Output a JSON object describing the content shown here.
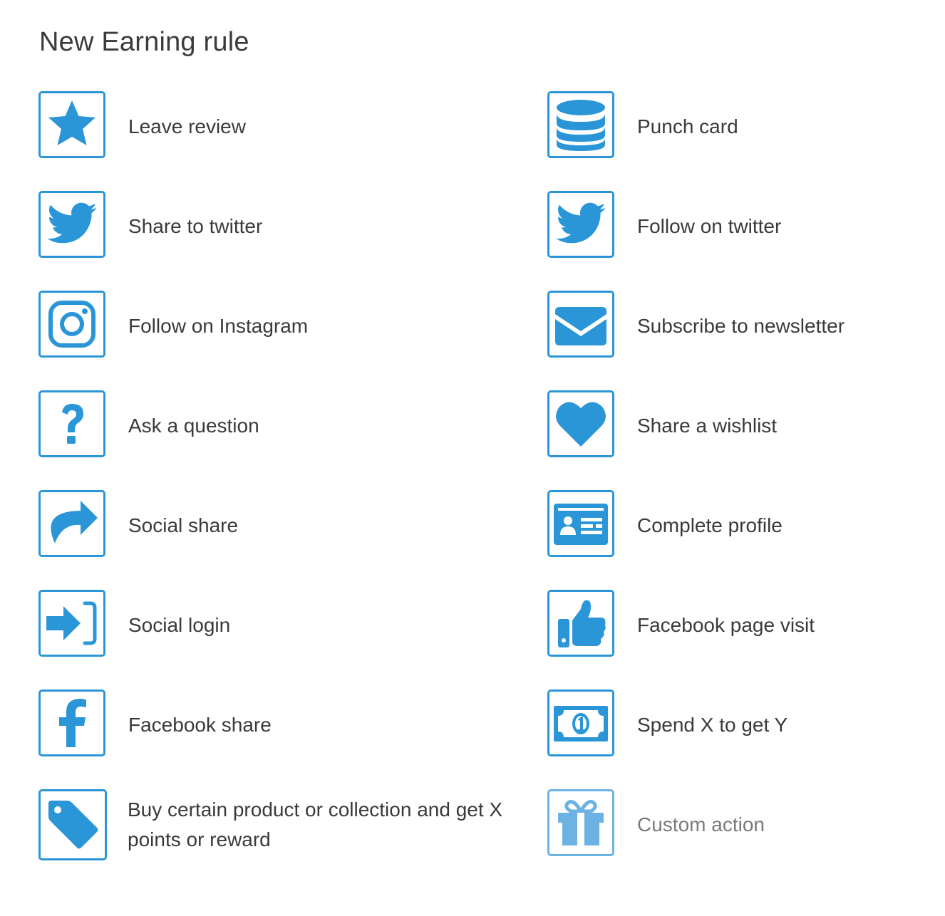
{
  "page": {
    "title": "New Earning rule"
  },
  "colors": {
    "accent": "#2a96d8",
    "accent_disabled": "#6cb3e3",
    "text": "#3a3a3a",
    "text_disabled": "#7a7a7a"
  },
  "rules": [
    {
      "label": "Leave review",
      "icon": "star-icon"
    },
    {
      "label": "Punch card",
      "icon": "database-icon"
    },
    {
      "label": "Share to twitter",
      "icon": "twitter-icon"
    },
    {
      "label": "Follow on twitter",
      "icon": "twitter-icon"
    },
    {
      "label": "Follow on Instagram",
      "icon": "instagram-icon"
    },
    {
      "label": "Subscribe to newsletter",
      "icon": "envelope-icon"
    },
    {
      "label": "Ask a question",
      "icon": "question-icon"
    },
    {
      "label": "Share a wishlist",
      "icon": "heart-icon"
    },
    {
      "label": "Social share",
      "icon": "share-arrow-icon"
    },
    {
      "label": "Complete profile",
      "icon": "id-card-icon"
    },
    {
      "label": "Social login",
      "icon": "sign-in-icon"
    },
    {
      "label": "Facebook page visit",
      "icon": "thumbs-up-icon"
    },
    {
      "label": "Facebook share",
      "icon": "facebook-icon"
    },
    {
      "label": "Spend X to get Y",
      "icon": "money-bill-icon"
    },
    {
      "label": "Buy certain product or collection and get X points or reward",
      "icon": "tag-icon"
    },
    {
      "label": "Custom action",
      "icon": "gift-icon",
      "state": "disabled"
    }
  ]
}
